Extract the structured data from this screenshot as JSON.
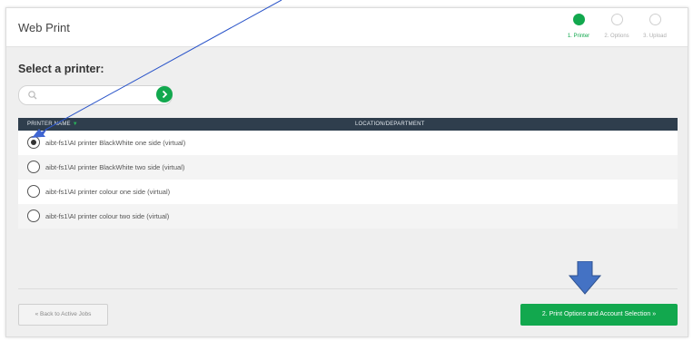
{
  "app": {
    "title": "Web Print"
  },
  "steps": [
    {
      "label": "1. Printer",
      "state": "active"
    },
    {
      "label": "2. Options",
      "state": "inactive"
    },
    {
      "label": "3. Upload",
      "state": "inactive"
    }
  ],
  "main": {
    "heading": "Select a printer:",
    "search": {
      "value": "",
      "placeholder": ""
    },
    "table": {
      "columns": {
        "name": "PRINTER NAME",
        "location": "LOCATION/DEPARTMENT",
        "sort_indicator": "▼"
      },
      "rows": [
        {
          "label": "aibt-fs1\\AI printer BlackWhite one side (virtual)",
          "location": "",
          "selected": true
        },
        {
          "label": "aibt-fs1\\AI printer BlackWhite two side (virtual)",
          "location": "",
          "selected": false
        },
        {
          "label": "aibt-fs1\\AI printer colour one side (virtual)",
          "location": "",
          "selected": false
        },
        {
          "label": "aibt-fs1\\AI printer colour two side (virtual)",
          "location": "",
          "selected": false
        }
      ]
    }
  },
  "footer": {
    "back_label": "« Back to Active Jobs",
    "next_label": "2. Print Options and Account Selection »"
  },
  "colors": {
    "accent_green": "#12a84e",
    "table_header": "#2f3e4d",
    "annotation_blue": "#4472c4"
  },
  "icons": {
    "search": "magnifier-icon",
    "search_go": "chevron-right-icon",
    "radio_selected": "radio-checked-icon",
    "annotation_arrow": "down-arrow-icon"
  }
}
